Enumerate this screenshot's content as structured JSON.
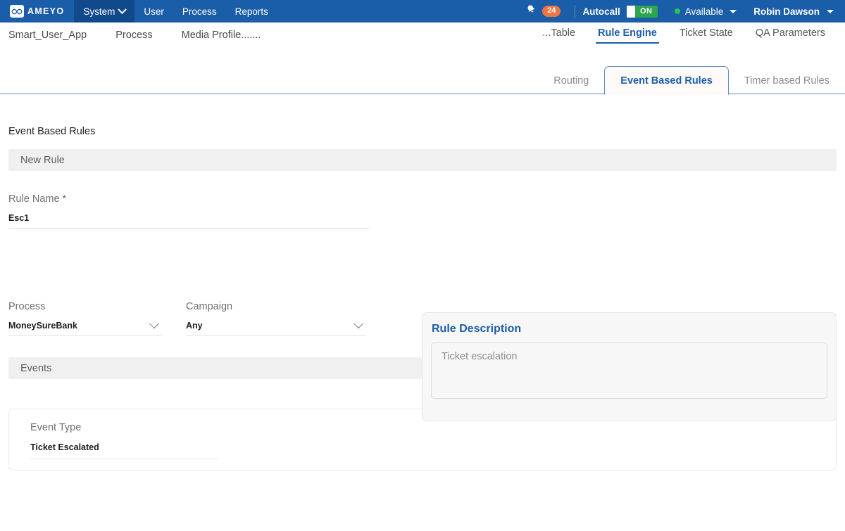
{
  "topnav": {
    "logo_text": "AMEYO",
    "logo_icon": "infinity-icon",
    "items": [
      {
        "label": "System",
        "icon": "chevron-down-icon",
        "active": true
      },
      {
        "label": "User",
        "active": false
      },
      {
        "label": "Process",
        "active": false
      },
      {
        "label": "Reports",
        "active": false
      }
    ],
    "bell_icon": "bell-icon",
    "notification_count": "24",
    "autocall_label": "Autocall",
    "autocall_state": "ON",
    "status_label": "Available",
    "status_color": "#29c44d",
    "user_name": "Robin Dawson",
    "bg_color": "#1a5da8",
    "active_bg_color": "#114a8c",
    "badge_color": "#ef7540",
    "toggle_on_color": "#2da44e"
  },
  "breadcrumb": {
    "items": [
      "Smart_User_App",
      "Process",
      "Media Profile......."
    ]
  },
  "main_tabs": [
    {
      "label": "...Table",
      "active": false
    },
    {
      "label": "Rule Engine",
      "active": true
    },
    {
      "label": "Ticket State",
      "active": false
    },
    {
      "label": "QA Parameters",
      "active": false
    }
  ],
  "sub_tabs": [
    {
      "label": "Routing",
      "active": false
    },
    {
      "label": "Event Based Rules",
      "active": true
    },
    {
      "label": "Timer based Rules",
      "active": false
    }
  ],
  "page": {
    "title": "Event Based Rules",
    "new_rule_section": "New Rule",
    "events_section": "Events"
  },
  "form": {
    "rule_name": {
      "label": "Rule Name *",
      "value": "Esc1"
    },
    "process": {
      "label": "Process",
      "value": "MoneySureBank",
      "icon": "chevron-down-icon"
    },
    "campaign": {
      "label": "Campaign",
      "value": "Any",
      "icon": "chevron-down-icon"
    },
    "description": {
      "title": "Rule Description",
      "value": "",
      "placeholder": "Ticket escalation"
    }
  },
  "events": {
    "event_type": {
      "label": "Event Type",
      "value": "Ticket Escalated"
    }
  },
  "colors": {
    "accent": "#1a5da8",
    "section_bar": "#f0f0f0",
    "tab_border": "#5f8fc0"
  }
}
